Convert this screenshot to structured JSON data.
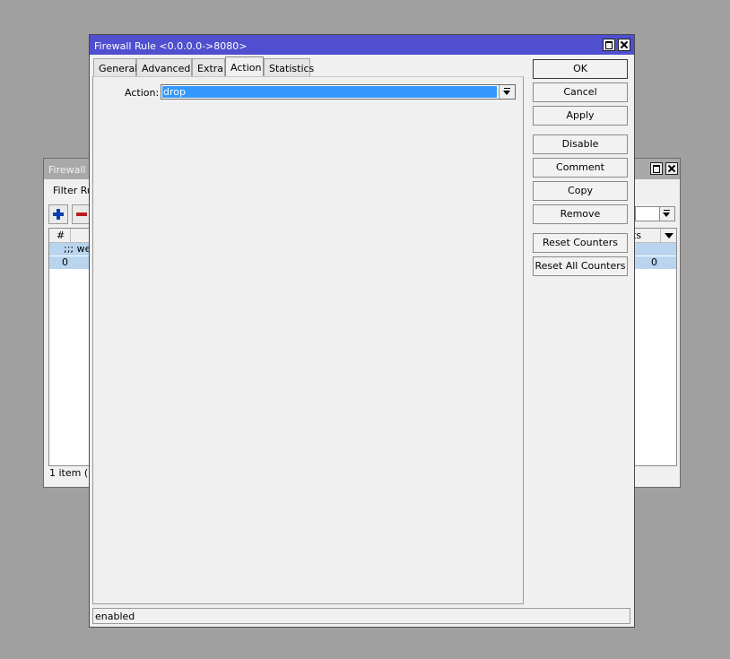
{
  "background_window": {
    "title": "Firewall",
    "tab_label": "Filter Rul",
    "table": {
      "col_num": "#",
      "col_right": "ts",
      "row1_text": ";;; web",
      "row2_num": "0",
      "row2_value": "0"
    },
    "status": "1 item (1"
  },
  "dialog": {
    "title": "Firewall Rule <0.0.0.0->8080>",
    "tabs": [
      {
        "label": "General"
      },
      {
        "label": "Advanced"
      },
      {
        "label": "Extra"
      },
      {
        "label": "Action"
      },
      {
        "label": "Statistics"
      }
    ],
    "active_tab": "Action",
    "action_field": {
      "label": "Action:",
      "value": "drop"
    },
    "buttons": {
      "ok": "OK",
      "cancel": "Cancel",
      "apply": "Apply",
      "disable": "Disable",
      "comment": "Comment",
      "copy": "Copy",
      "remove": "Remove",
      "reset_counters": "Reset Counters",
      "reset_all_counters": "Reset All Counters"
    },
    "status": "enabled"
  },
  "colors": {
    "desktop": "#a0a0a0",
    "active_title": "#4f4fcf",
    "inactive_title": "#a9a9a9",
    "selection": "#3399ff",
    "row_highlight": "#b8d4ee"
  }
}
